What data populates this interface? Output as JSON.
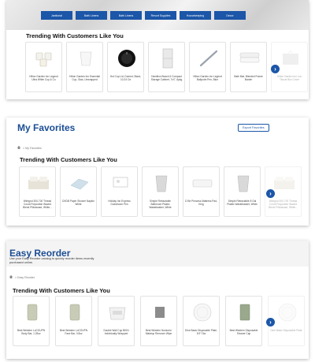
{
  "categories": [
    "Janitorial",
    "Bath Linens",
    "Bath Linens",
    "Resort Supplies",
    "Housekeeping",
    "Decor"
  ],
  "panel1": {
    "trending_title": "Trending With Customers Like You",
    "products": [
      {
        "name": "Hilton Garden Inn Legend Ultra White Cup & Co",
        "icon": "mug-set-icon"
      },
      {
        "name": "Hilton Garden Inn Essential Cup, Glas, Unwrapped",
        "icon": "cups-stack-icon"
      },
      {
        "name": "Hot Cup Lid, Domed, Black, 10-24 Oz",
        "icon": "black-lid-icon"
      },
      {
        "name": "Hamilton Beach 6 Compact Storage Cabinet, 7x/7, 6pkg",
        "icon": "cabinet-icon"
      },
      {
        "name": "Hilton Garden Inn Legend Ballpoint Pen, Blue",
        "icon": "pen-icon"
      },
      {
        "name": "Bath Mat, Blended Frame Border",
        "icon": "towel-stack-icon"
      },
      {
        "name": "Hilton Garden Inn Lux Tissue Box Cover",
        "icon": "tissue-box-icon",
        "faded": true
      }
    ]
  },
  "panel2": {
    "title": "My Favorites",
    "export_label": "Export Favorites",
    "breadcrumb": "My Favorites",
    "trending_title": "Trending With Customers Like You",
    "products": [
      {
        "name": "Wintgrut 300-700 Thread Count Polycotton Waved Blend Pillowcase, White...",
        "icon": "bedding-icon"
      },
      {
        "name": "DXDB Paper Shower Napkin White",
        "icon": "napkin-icon"
      },
      {
        "name": "Holiday Inn Express Guestroom Pen",
        "icon": "placeholder-icon"
      },
      {
        "name": "Simple Retractable Bathroom Plastic Wastebasket, White",
        "icon": "wastebasket-icon"
      },
      {
        "name": "D Be Princess Mattress Pad, King",
        "icon": "mattress-icon"
      },
      {
        "name": "Simple Retractable 8 Gal Plastic Wastebasket, White",
        "icon": "wastebasket-icon"
      },
      {
        "name": "Wintgrut 300-700 Thread Count Polycotton Waved Blend Pillowcase, White...",
        "icon": "bedding-icon",
        "faded": true
      }
    ]
  },
  "panel3": {
    "title": "Easy Reorder",
    "description": "Use your Easy Reorder catalog to quickly reorder items recently purchased online.",
    "breadcrumb": "Easy Reorder",
    "trending_title": "Trending With Customers Like You",
    "products": [
      {
        "name": "Best Western LoCOUPN Body Bar, 1.25oz",
        "icon": "soap-bar-icon"
      },
      {
        "name": "Best Western LoCOUPN Face Bar, 0.8oz",
        "icon": "soap-bar-icon"
      },
      {
        "name": "Double Wall Cup BKIN Individually Wrapped",
        "icon": "cup-bucket-icon"
      },
      {
        "name": "Best Western Nocturne Makeup Remover Wipe",
        "icon": "wipe-icon"
      },
      {
        "name": "Dine Basic Disposable Plate, 8.9\" Dia",
        "icon": "plate-icon"
      },
      {
        "name": "Best Western Disposable Shower Cap",
        "icon": "shower-cap-icon"
      },
      {
        "name": "Dine Basic Disposable Plate",
        "icon": "plate-icon",
        "faded": true
      }
    ]
  },
  "colors": {
    "brand_blue": "#1b56a8",
    "title_blue": "#1b4d93"
  }
}
